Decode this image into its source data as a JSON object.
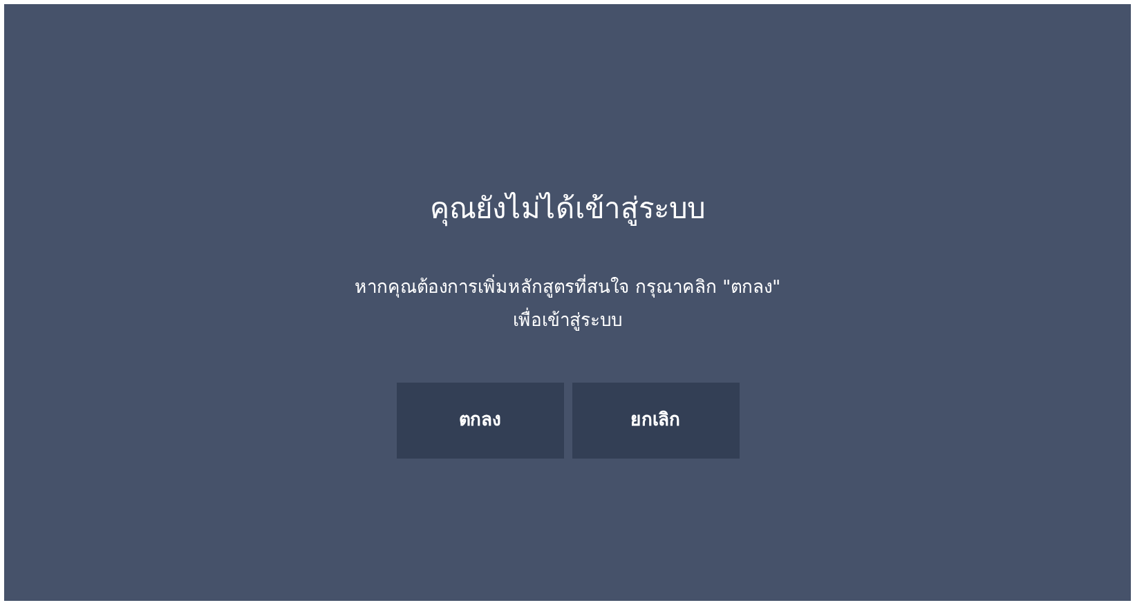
{
  "dialog": {
    "title": "คุณยังไม่ได้เข้าสู่ระบบ",
    "message": "หากคุณต้องการเพิ่มหลักสูตรที่สนใจ กรุณาคลิก \"ตกลง\"",
    "message_line_2": "เพื่อเข้าสู่ระบบ",
    "buttons": [
      {
        "label": "ตกลง"
      },
      {
        "label": "ยกเลิก"
      }
    ]
  }
}
